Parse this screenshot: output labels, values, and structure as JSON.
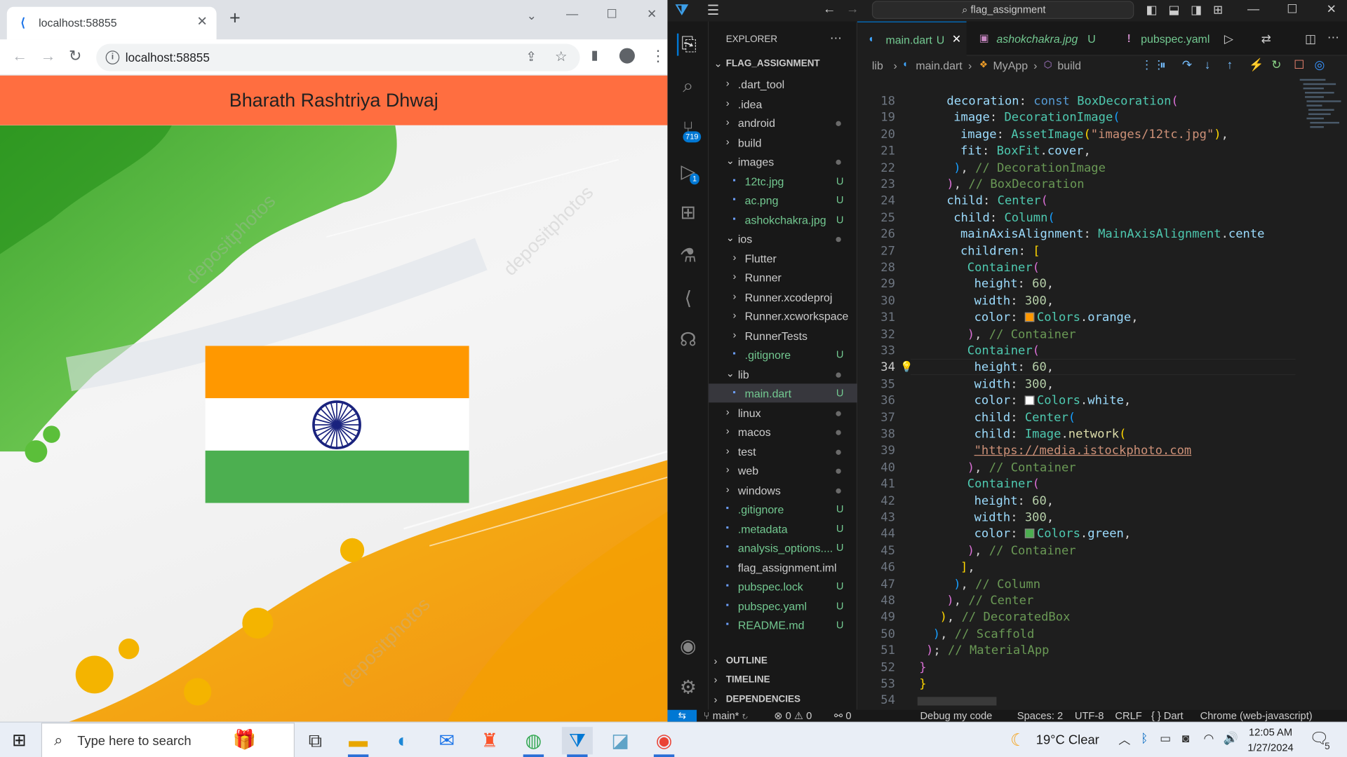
{
  "browser": {
    "tab_title": "localhost:58855",
    "tab_close": "✕",
    "new_tab": "+",
    "address": "localhost:58855",
    "window_controls": [
      "⌄",
      "—",
      "☐",
      "✕"
    ]
  },
  "app": {
    "title": "Bharath Rashtriya Dhwaj",
    "watermark": "depositphotos",
    "flag": {
      "top": "#ff9800",
      "middle": "#ffffff",
      "bottom": "#4caf50",
      "chakra": "#1a237e"
    },
    "appbar_color": "#ff6e40"
  },
  "vscode": {
    "command_center": "flag_assignment",
    "explorer_title": "EXPLORER",
    "project": "FLAG_ASSIGNMENT",
    "badges": {
      "scm": "719",
      "debug": "1"
    },
    "tree": [
      {
        "label": ".dart_tool",
        "type": "folder",
        "open": false,
        "indent": 0
      },
      {
        "label": ".idea",
        "type": "folder",
        "open": false,
        "indent": 0
      },
      {
        "label": "android",
        "type": "folder",
        "open": false,
        "indent": 0,
        "dot": true
      },
      {
        "label": "build",
        "type": "folder",
        "open": false,
        "indent": 0
      },
      {
        "label": "images",
        "type": "folder",
        "open": true,
        "indent": 0,
        "dot": true
      },
      {
        "label": "12tc.jpg",
        "type": "file",
        "indent": 1,
        "mark": "U"
      },
      {
        "label": "ac.png",
        "type": "file",
        "indent": 1,
        "mark": "U"
      },
      {
        "label": "ashokchakra.jpg",
        "type": "file",
        "indent": 1,
        "mark": "U"
      },
      {
        "label": "ios",
        "type": "folder",
        "open": true,
        "indent": 0,
        "dot": true
      },
      {
        "label": "Flutter",
        "type": "folder",
        "open": false,
        "indent": 1
      },
      {
        "label": "Runner",
        "type": "folder",
        "open": false,
        "indent": 1
      },
      {
        "label": "Runner.xcodeproj",
        "type": "folder",
        "open": false,
        "indent": 1
      },
      {
        "label": "Runner.xcworkspace",
        "type": "folder",
        "open": false,
        "indent": 1
      },
      {
        "label": "RunnerTests",
        "type": "folder",
        "open": false,
        "indent": 1
      },
      {
        "label": ".gitignore",
        "type": "file",
        "indent": 1,
        "mark": "U"
      },
      {
        "label": "lib",
        "type": "folder",
        "open": true,
        "indent": 0,
        "dot": true
      },
      {
        "label": "main.dart",
        "type": "file",
        "indent": 1,
        "mark": "U",
        "selected": true
      },
      {
        "label": "linux",
        "type": "folder",
        "open": false,
        "indent": 0,
        "dot": true
      },
      {
        "label": "macos",
        "type": "folder",
        "open": false,
        "indent": 0,
        "dot": true
      },
      {
        "label": "test",
        "type": "folder",
        "open": false,
        "indent": 0,
        "dot": true
      },
      {
        "label": "web",
        "type": "folder",
        "open": false,
        "indent": 0,
        "dot": true
      },
      {
        "label": "windows",
        "type": "folder",
        "open": false,
        "indent": 0,
        "dot": true
      },
      {
        "label": ".gitignore",
        "type": "file",
        "indent": 0,
        "mark": "U"
      },
      {
        "label": ".metadata",
        "type": "file",
        "indent": 0,
        "mark": "U"
      },
      {
        "label": "analysis_options....",
        "type": "file",
        "indent": 0,
        "mark": "U"
      },
      {
        "label": "flag_assignment.iml",
        "type": "file",
        "indent": 0
      },
      {
        "label": "pubspec.lock",
        "type": "file",
        "indent": 0,
        "mark": "U"
      },
      {
        "label": "pubspec.yaml",
        "type": "file",
        "indent": 0,
        "mark": "U"
      },
      {
        "label": "README.md",
        "type": "file",
        "indent": 0,
        "mark": "U"
      }
    ],
    "panels": [
      "OUTLINE",
      "TIMELINE",
      "DEPENDENCIES"
    ],
    "editor_tabs": [
      {
        "label": "main.dart",
        "mark": "U",
        "active": true
      },
      {
        "label": "ashokchakra.jpg",
        "mark": "U",
        "active": false
      },
      {
        "label": "pubspec.yaml",
        "mark": "",
        "active": false
      }
    ],
    "breadcrumb": [
      "lib",
      "main.dart",
      "MyApp",
      "build"
    ],
    "code_lines": [
      {
        "n": "18",
        "html": "      <span class='prop'>decoration</span>: <span class='kw'>const</span> <span class='cls'>BoxDecoration</span><span class='br2'>(</span>"
      },
      {
        "n": "19",
        "html": "        <span class='prop'>image</span>: <span class='cls'>DecorationImage</span><span class='br3'>(</span>"
      },
      {
        "n": "20",
        "html": "          <span class='prop'>image</span>: <span class='cls'>AssetImage</span><span class='br1'>(</span><span class='str'>\"images/12tc.jpg\"</span><span class='br1'>)</span>,"
      },
      {
        "n": "21",
        "html": "          <span class='prop'>fit</span>: <span class='cls'>BoxFit</span>.<span class='prop'>cover</span>,"
      },
      {
        "n": "22",
        "html": "        <span class='br3'>)</span>, <span class='cm'>// DecorationImage</span>"
      },
      {
        "n": "23",
        "html": "      <span class='br2'>)</span>, <span class='cm'>// BoxDecoration</span>"
      },
      {
        "n": "24",
        "html": "      <span class='prop'>child</span>: <span class='cls'>Center</span><span class='br2'>(</span>"
      },
      {
        "n": "25",
        "html": "        <span class='prop'>child</span>: <span class='cls'>Column</span><span class='br3'>(</span>"
      },
      {
        "n": "26",
        "html": "          <span class='prop'>mainAxisAlignment</span>: <span class='cls'>MainAxisAlignment</span>.<span class='prop'>cente</span>"
      },
      {
        "n": "27",
        "html": "          <span class='prop'>children</span>: <span class='br1'>[</span>"
      },
      {
        "n": "28",
        "html": "            <span class='cls'>Container</span><span class='br2'>(</span>"
      },
      {
        "n": "29",
        "html": "              <span class='prop'>height</span>: <span class='num'>60</span>,"
      },
      {
        "n": "30",
        "html": "              <span class='prop'>width</span>: <span class='num'>300</span>,"
      },
      {
        "n": "31",
        "html": "              <span class='prop'>color</span>: <span class='sw' style='background:#ff9800'></span><span class='cls'>Colors</span>.<span class='prop'>orange</span>,"
      },
      {
        "n": "32",
        "html": "            <span class='br2'>)</span>, <span class='cm'>// Container</span>"
      },
      {
        "n": "33",
        "html": "            <span class='cls'>Container</span><span class='br2'>(</span>"
      },
      {
        "n": "34",
        "html": "              <span class='prop'>height</span>: <span class='num'>60</span>,"
      },
      {
        "n": "35",
        "html": "              <span class='prop'>width</span>: <span class='num'>300</span>,"
      },
      {
        "n": "36",
        "html": "              <span class='prop'>color</span>: <span class='sw' style='background:#ffffff'></span><span class='cls'>Colors</span>.<span class='prop'>white</span>,"
      },
      {
        "n": "37",
        "html": "              <span class='prop'>child</span>: <span class='cls'>Center</span><span class='br3'>(</span>"
      },
      {
        "n": "38",
        "html": "                  <span class='prop'>child</span>: <span class='cls'>Image</span>.<span class='fn'>network</span><span class='br1'>(</span>"
      },
      {
        "n": "39",
        "html": "                      <span class='str' style='text-decoration:underline'>\"https://media.istockphoto.com</span>"
      },
      {
        "n": "40",
        "html": "            <span class='br2'>)</span>, <span class='cm'>// Container</span>"
      },
      {
        "n": "41",
        "html": "            <span class='cls'>Container</span><span class='br2'>(</span>"
      },
      {
        "n": "42",
        "html": "              <span class='prop'>height</span>: <span class='num'>60</span>,"
      },
      {
        "n": "43",
        "html": "              <span class='prop'>width</span>: <span class='num'>300</span>,"
      },
      {
        "n": "44",
        "html": "              <span class='prop'>color</span>: <span class='sw' style='background:#4caf50'></span><span class='cls'>Colors</span>.<span class='prop'>green</span>,"
      },
      {
        "n": "45",
        "html": "            <span class='br2'>)</span>, <span class='cm'>// Container</span>"
      },
      {
        "n": "46",
        "html": "          <span class='br1'>]</span>,"
      },
      {
        "n": "47",
        "html": "        <span class='br3'>)</span>, <span class='cm'>// Column</span>"
      },
      {
        "n": "48",
        "html": "      <span class='br2'>)</span>, <span class='cm'>// Center</span>"
      },
      {
        "n": "49",
        "html": "    <span class='br1'>)</span>, <span class='cm'>// DecoratedBox</span>"
      },
      {
        "n": "50",
        "html": "  <span class='br3'>)</span>, <span class='cm'>// Scaffold</span>"
      },
      {
        "n": "51",
        "html": "<span class='br2'>)</span>; <span class='cm'>// MaterialApp</span>"
      },
      {
        "n": "52",
        "html": "<span class='br2'>}</span>"
      },
      {
        "n": "53",
        "html": "<span class='br1'>}</span>"
      },
      {
        "n": "54",
        "html": ""
      }
    ],
    "code_offsets": [
      4,
      5,
      6,
      6,
      5,
      4,
      4,
      5,
      6,
      6,
      7,
      8,
      8,
      8,
      7,
      7,
      8,
      8,
      8,
      8,
      8,
      8,
      7,
      7,
      8,
      8,
      8,
      7,
      6,
      5,
      4,
      3,
      2,
      1,
      0,
      0,
      0
    ],
    "current_line": "34",
    "status": {
      "branch": "main*",
      "errors": "⊗ 0 ⚠ 0",
      "ports": "0",
      "debug": "Debug my code",
      "spaces": "Spaces: 2",
      "encoding": "UTF-8",
      "eol": "CRLF",
      "lang": "{ } Dart",
      "device": "Chrome (web-javascript)"
    }
  },
  "taskbar": {
    "search_placeholder": "Type here to search",
    "weather": "19°C  Clear",
    "time": "12:05 AM",
    "date": "1/27/2024",
    "notifications": "5"
  }
}
